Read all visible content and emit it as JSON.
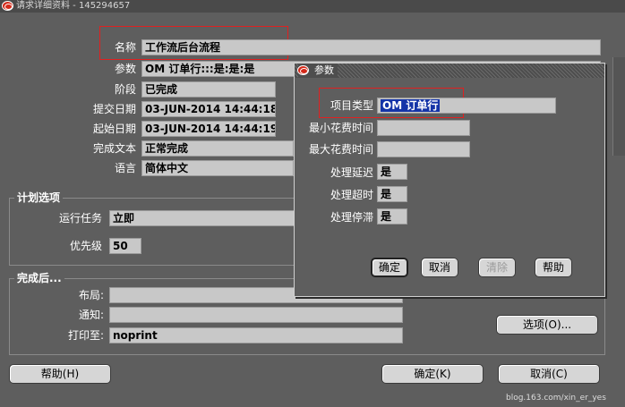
{
  "window": {
    "title": "请求详细资料 - 145294657"
  },
  "main": {
    "name_label": "名称",
    "name_value": "工作流后台流程",
    "params_label": "参数",
    "params_value": "OM 订单行:::是:是:是",
    "phase_label": "阶段",
    "phase_value": "已完成",
    "submit_label": "提交日期",
    "submit_value": "03-JUN-2014 14:44:18",
    "start_label": "起始日期",
    "start_value": "03-JUN-2014 14:44:19",
    "completion_label": "完成文本",
    "completion_value": "正常完成",
    "language_label": "语言",
    "language_value": "简体中文"
  },
  "schedule": {
    "title": "计划选项",
    "run_label": "运行任务",
    "run_value": "立即",
    "priority_label": "优先级",
    "priority_value": "50"
  },
  "upon_completion": {
    "title": "完成后...",
    "layout_label": "布局:",
    "layout_value": "",
    "notify_label": "通知:",
    "notify_value": "",
    "print_label": "打印至:",
    "print_value": "noprint",
    "options_button": "选项(O)..."
  },
  "footer": {
    "help_button": "帮助(H)",
    "ok_button": "确定(K)",
    "cancel_button": "取消(C)"
  },
  "dialog": {
    "title": "参数",
    "item_type_label": "项目类型",
    "item_type_value": "OM 订单行",
    "min_cost_label": "最小花费时间",
    "min_cost_value": "",
    "max_cost_label": "最大花费时间",
    "max_cost_value": "",
    "deferred_label": "处理延迟",
    "deferred_value": "是",
    "timeout_label": "处理超时",
    "timeout_value": "是",
    "stuck_label": "处理停滞",
    "stuck_value": "是",
    "ok_button": "确定",
    "cancel_button": "取消",
    "clear_button": "清除",
    "help_button": "帮助"
  },
  "watermark": "blog.163.com/xin_er_yes",
  "colors": {
    "background": "#5e5e5e",
    "field": "#c8c8c8",
    "highlight_box": "#e02020",
    "selection": "#1434a8",
    "logo": "#d42a1a"
  }
}
